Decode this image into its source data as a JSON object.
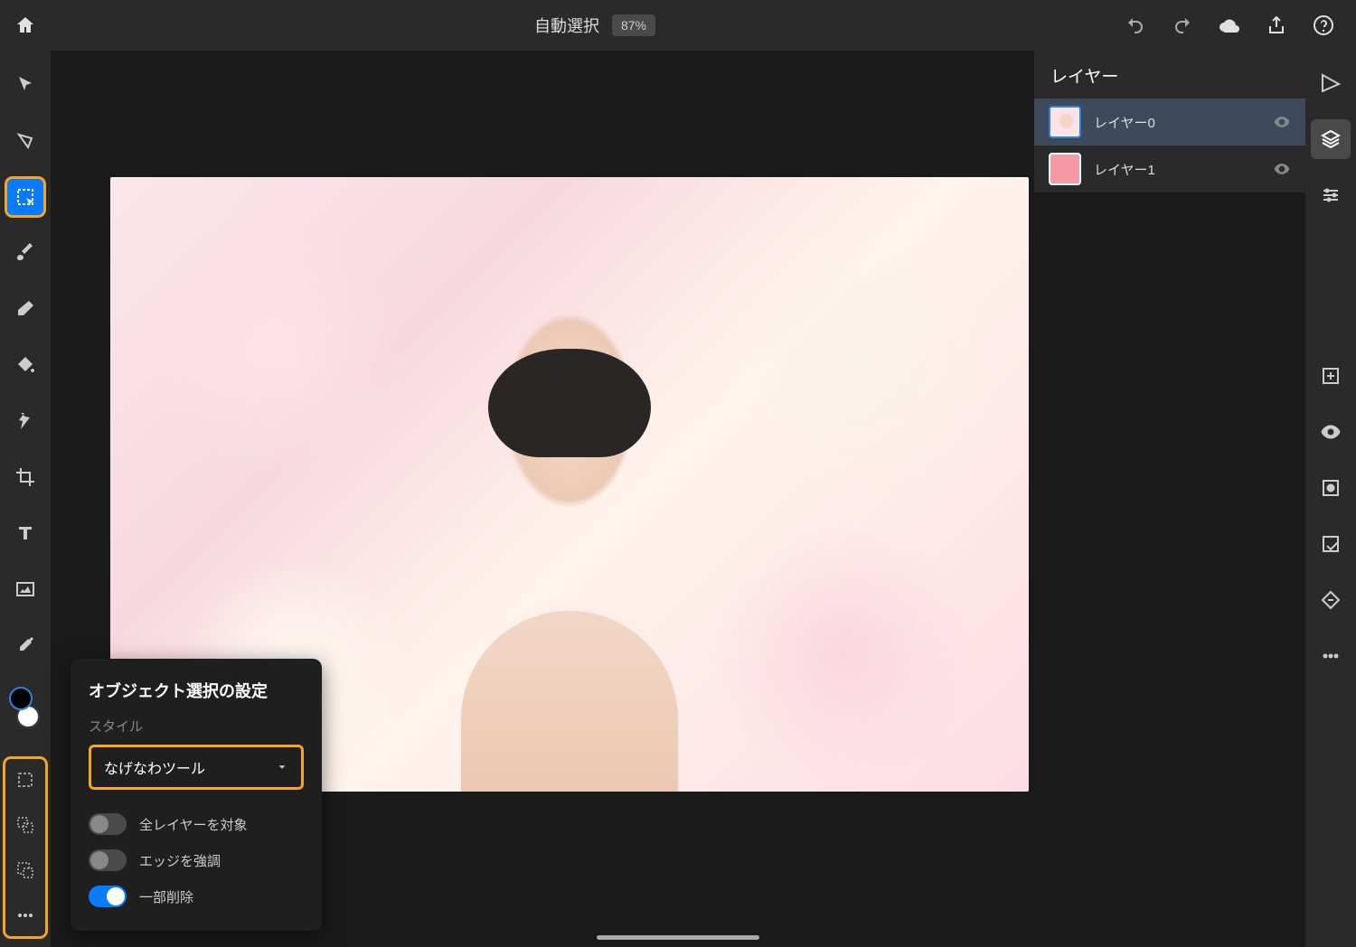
{
  "topbar": {
    "tool_name": "自動選択",
    "zoom": "87%"
  },
  "layers": {
    "title": "レイヤー",
    "items": [
      {
        "name": "レイヤー0"
      },
      {
        "name": "レイヤー1"
      }
    ]
  },
  "popover": {
    "title": "オブジェクト選択の設定",
    "style_label": "スタイル",
    "dropdown_value": "なげなわツール",
    "toggles": [
      {
        "label": "全レイヤーを対象",
        "on": false
      },
      {
        "label": "エッジを強調",
        "on": false
      },
      {
        "label": "一部削除",
        "on": true
      }
    ]
  }
}
